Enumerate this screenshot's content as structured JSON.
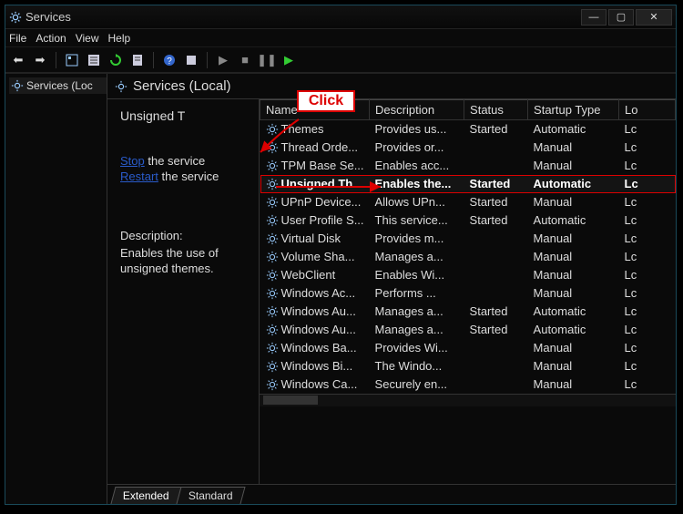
{
  "window": {
    "title": "Services"
  },
  "menubar": {
    "file": "File",
    "action": "Action",
    "view": "View",
    "help": "Help"
  },
  "left": {
    "root": "Services (Loc"
  },
  "pane": {
    "title": "Services (Local)"
  },
  "callout": {
    "click": "Click"
  },
  "detail": {
    "selected_name": "Unsigned T",
    "stop_link": "Stop",
    "stop_rest": " the service",
    "restart_link": "Restart",
    "restart_rest": " the service",
    "desc_header": "Description:",
    "desc_body": "Enables the use of unsigned themes."
  },
  "columns": {
    "name": "Name",
    "description": "Description",
    "status": "Status",
    "startup": "Startup Type",
    "logon": "Lo"
  },
  "services": [
    {
      "name": "Themes",
      "desc": "Provides us...",
      "status": "Started",
      "startup": "Automatic",
      "logon": "Lc"
    },
    {
      "name": "Thread Orde...",
      "desc": "Provides or...",
      "status": "",
      "startup": "Manual",
      "logon": "Lc"
    },
    {
      "name": "TPM Base Se...",
      "desc": "Enables acc...",
      "status": "",
      "startup": "Manual",
      "logon": "Lc"
    },
    {
      "name": "Unsigned Th...",
      "desc": "Enables the...",
      "status": "Started",
      "startup": "Automatic",
      "logon": "Lc",
      "selected": true
    },
    {
      "name": "UPnP Device...",
      "desc": "Allows UPn...",
      "status": "Started",
      "startup": "Manual",
      "logon": "Lc"
    },
    {
      "name": "User Profile S...",
      "desc": "This service...",
      "status": "Started",
      "startup": "Automatic",
      "logon": "Lc"
    },
    {
      "name": "Virtual Disk",
      "desc": "Provides m...",
      "status": "",
      "startup": "Manual",
      "logon": "Lc"
    },
    {
      "name": "Volume Sha...",
      "desc": "Manages a...",
      "status": "",
      "startup": "Manual",
      "logon": "Lc"
    },
    {
      "name": "WebClient",
      "desc": "Enables Wi...",
      "status": "",
      "startup": "Manual",
      "logon": "Lc"
    },
    {
      "name": "Windows Ac...",
      "desc": "Performs ...",
      "status": "",
      "startup": "Manual",
      "logon": "Lc"
    },
    {
      "name": "Windows Au...",
      "desc": "Manages a...",
      "status": "Started",
      "startup": "Automatic",
      "logon": "Lc"
    },
    {
      "name": "Windows Au...",
      "desc": "Manages a...",
      "status": "Started",
      "startup": "Automatic",
      "logon": "Lc"
    },
    {
      "name": "Windows Ba...",
      "desc": "Provides Wi...",
      "status": "",
      "startup": "Manual",
      "logon": "Lc"
    },
    {
      "name": "Windows Bi...",
      "desc": "The Windo...",
      "status": "",
      "startup": "Manual",
      "logon": "Lc"
    },
    {
      "name": "Windows Ca...",
      "desc": "Securely en...",
      "status": "",
      "startup": "Manual",
      "logon": "Lc"
    }
  ],
  "tabs": {
    "extended": "Extended",
    "standard": "Standard"
  }
}
